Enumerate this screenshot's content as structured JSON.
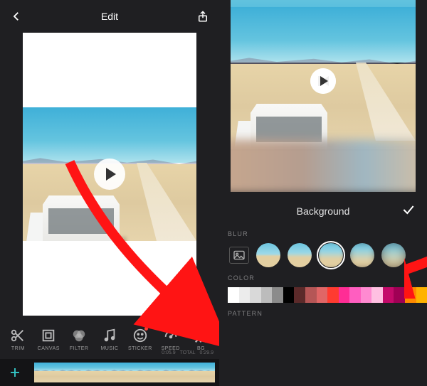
{
  "header": {
    "title": "Edit"
  },
  "toolbar": {
    "items": [
      {
        "label": "TRIM"
      },
      {
        "label": "CANVAS"
      },
      {
        "label": "FILTER"
      },
      {
        "label": "MUSIC"
      },
      {
        "label": "STICKER"
      },
      {
        "label": "SPEED"
      },
      {
        "label": "BG"
      }
    ]
  },
  "timeline": {
    "current": "0:05.9",
    "total_label": "TOTAL",
    "total": "0:29.9"
  },
  "background_panel": {
    "title": "Background",
    "section_blur": "BLUR",
    "section_color": "COLOR",
    "section_pattern": "PATTERN",
    "selected_blur_index": 2,
    "colors": [
      "#ffffff",
      "#ececec",
      "#d9d9d9",
      "#bcbcbc",
      "#8b8b8b",
      "#000000",
      "#5b2a2a",
      "#b55656",
      "#e06666",
      "#ff3b30",
      "#ff2d95",
      "#ff5ec0",
      "#ff8ad1",
      "#ffc0e2",
      "#c40a6a",
      "#a00055",
      "#ff8a00",
      "#ffb300"
    ]
  },
  "icons": {
    "back": "chevron-left",
    "share": "share",
    "play": "play",
    "skip_back": "skip-back",
    "add": "plus",
    "confirm": "check",
    "image": "image"
  }
}
